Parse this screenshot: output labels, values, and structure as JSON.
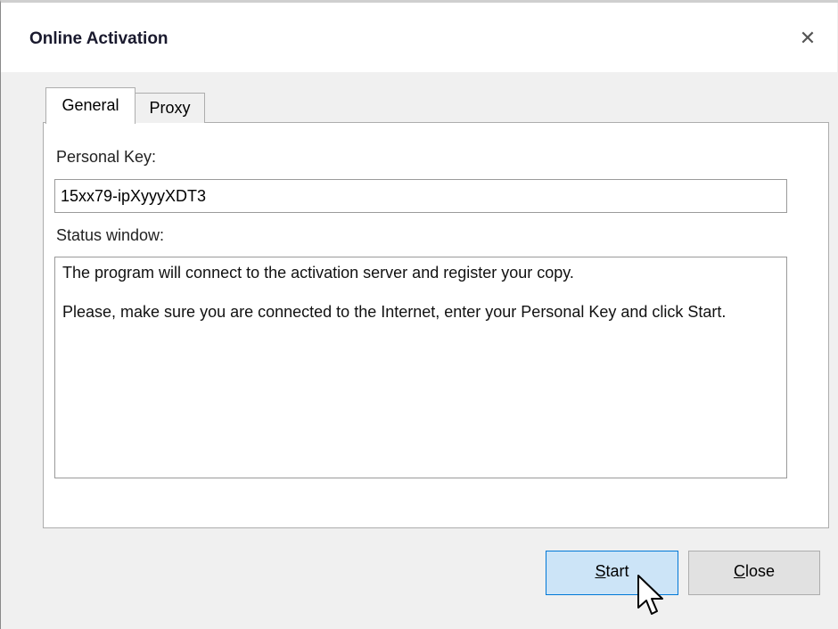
{
  "window": {
    "title": "Online Activation",
    "close_glyph": "✕"
  },
  "tabs": [
    {
      "label": "General",
      "selected": true
    },
    {
      "label": "Proxy",
      "selected": false
    }
  ],
  "general": {
    "personal_key_label": "Personal Key:",
    "personal_key_value": "15xx79-ipXyyyXDT3",
    "status_label": "Status window:",
    "status_lines": [
      "The program will connect to the activation server and register your copy.",
      "Please, make sure you are connected to the Internet, enter your Personal Key and click Start."
    ]
  },
  "buttons": {
    "start": {
      "mnemonic": "S",
      "rest": "tart"
    },
    "close": {
      "mnemonic": "C",
      "rest": "lose"
    }
  },
  "colors": {
    "accent": "#0078d7",
    "start_button_bg": "#cce4f7",
    "dialog_bg": "#f0f0f0"
  },
  "icons": {
    "pointer": "mouse-pointer-icon"
  }
}
